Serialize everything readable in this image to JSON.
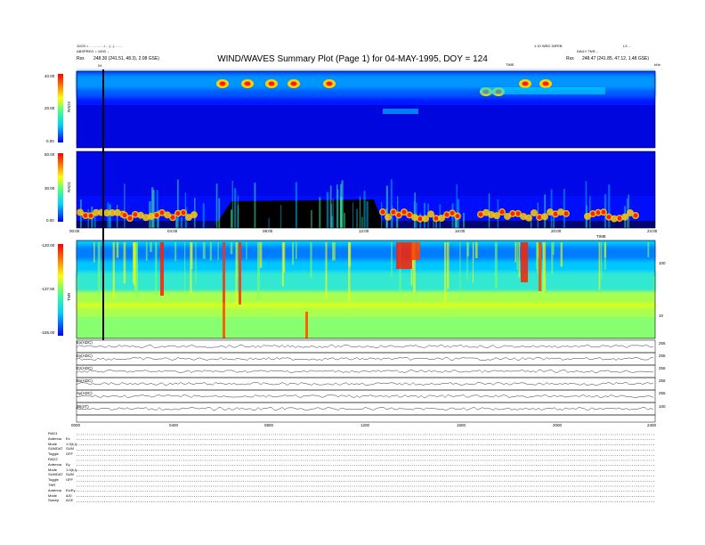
{
  "header": {
    "left_line1": "11/03 = ...  ...  ...  .../...  (...) ...  ...",
    "left_line2": "ABSPREG = 1000 ...",
    "left_rpos_label": "Rsx",
    "left_rpos_value": "248.30 (241.51, 48.3), 2.08 GSE)",
    "title": "WIND/WAVES Summary Plot (Page 1) for 04-MAY-1995, DOY = 124",
    "right_line1": "1.10 WED 30FEB",
    "right_line2": "DAILY TNR...",
    "right_corner": "L3 ...",
    "right_rpos_label": "Rsx",
    "right_rpos_value": "248.47 (241.85, 47.12, 1.48 GSE)",
    "time_label_top": "TIME",
    "time_label_mid": "TIME",
    "khz": "kHz"
  },
  "panels": {
    "rad2": {
      "name": "RAD2",
      "ticks": [
        "40.00",
        "20.00",
        "0.00"
      ]
    },
    "rad1": {
      "name": "RAD1",
      "ticks": [
        "50.00",
        "30.00",
        "0.00"
      ]
    },
    "tnr": {
      "name": "TNR",
      "ticks": [
        "-120.00",
        "-137.50",
        "-155.00"
      ],
      "right_ticks": [
        "100",
        "10"
      ]
    }
  },
  "time_ticks": [
    "00:00",
    "04:00",
    "08:00",
    "12:00",
    "16:00",
    "20:00",
    "24:00"
  ],
  "lower_time_ticks": [
    "0000",
    "0400",
    "0800",
    "1200",
    "1600",
    "2000",
    "2400"
  ],
  "strip_labels": [
    "Ex(ADC)",
    "Ey(ADC)",
    "Ez(ADC)",
    "Bx(ADC)",
    "Ay(ADC)",
    "|B|(nT)"
  ],
  "strip_right_ticks": [
    "255",
    "255",
    "255",
    "255",
    "255",
    "100"
  ],
  "cursor_label": "04",
  "footer_rows": [
    {
      "k": "RAD1",
      "v": ""
    },
    {
      "k": "Antenna",
      "v": "Ex"
    },
    {
      "k": "Mode",
      "v": "1.0(k,l)"
    },
    {
      "k": "SUMDAT",
      "v": "SUM"
    },
    {
      "k": "Toggle",
      "v": "OFF"
    },
    {
      "k": "RAD2",
      "v": ""
    },
    {
      "k": "Antenna",
      "v": "Ey"
    },
    {
      "k": "Mode",
      "v": "1.0(k,l)"
    },
    {
      "k": "SUMDAT",
      "v": "SUM"
    },
    {
      "k": "Toggle",
      "v": "OFF"
    },
    {
      "k": "TNR",
      "v": ""
    },
    {
      "k": "Antenna",
      "v": "Ex/Ey"
    },
    {
      "k": "Mode",
      "v": "A/D"
    },
    {
      "k": "Sweep",
      "v": "ACE"
    }
  ],
  "chart_data": {
    "type": "heatmap",
    "title": "WIND/WAVES Summary Plot (Page 1) for 04-MAY-1995, DOY = 124",
    "xlabel": "TIME",
    "xlim": [
      "00:00",
      "24:00"
    ],
    "panels": [
      {
        "name": "RAD2",
        "ylim": [
          0,
          40
        ]
      },
      {
        "name": "RAD1",
        "ylim": [
          0,
          50
        ]
      },
      {
        "name": "TNR",
        "ylim": [
          -155,
          -120
        ]
      }
    ],
    "colormap": [
      "#00007a",
      "#0000ff",
      "#00b0ff",
      "#00ffff",
      "#7fff7f",
      "#ffff00",
      "#ff8000",
      "#ff0000"
    ]
  }
}
